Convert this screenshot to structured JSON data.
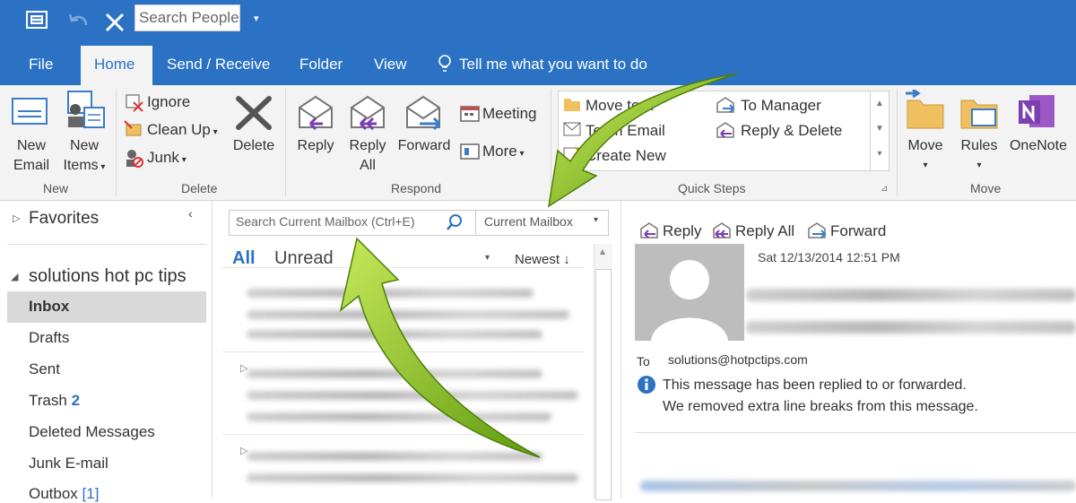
{
  "titlebar": {
    "search_people_placeholder": "Search People"
  },
  "tabs": {
    "file": "File",
    "home": "Home",
    "send_receive": "Send / Receive",
    "folder": "Folder",
    "view": "View",
    "tell_me": "Tell me what you want to do"
  },
  "ribbon": {
    "new_email": [
      "New",
      "Email"
    ],
    "new_items": [
      "New",
      "Items"
    ],
    "group_new": "New",
    "ignore": "Ignore",
    "clean_up": "Clean Up",
    "junk": "Junk",
    "delete": "Delete",
    "group_delete": "Delete",
    "reply": "Reply",
    "reply_all": [
      "Reply",
      "All"
    ],
    "forward": "Forward",
    "meeting": "Meeting",
    "more": "More",
    "group_respond": "Respond",
    "quick_steps": {
      "move_to": "Move to: ?",
      "team_email": "Team Email",
      "create_new": "Create New",
      "to_manager": "To Manager",
      "reply_delete": "Reply & Delete"
    },
    "group_quick_steps": "Quick Steps",
    "move": "Move",
    "rules": "Rules",
    "onenote": "OneNote",
    "group_move": "Move"
  },
  "nav": {
    "favorites": "Favorites",
    "account": "solutions hot pc tips",
    "folders": [
      {
        "label": "Inbox",
        "count": "",
        "selected": true
      },
      {
        "label": "Drafts",
        "count": ""
      },
      {
        "label": "Sent",
        "count": ""
      },
      {
        "label": "Trash",
        "count": "2"
      },
      {
        "label": "Deleted Messages",
        "count": ""
      },
      {
        "label": "Junk E-mail",
        "count": ""
      },
      {
        "label": "Outbox",
        "count": "[1]"
      }
    ]
  },
  "list": {
    "search_placeholder": "Search Current Mailbox (Ctrl+E)",
    "scope": "Current Mailbox",
    "filter_all": "All",
    "filter_unread": "Unread",
    "sort": "Newest"
  },
  "reading": {
    "reply": "Reply",
    "reply_all": "Reply All",
    "forward": "Forward",
    "date": "Sat 12/13/2014 12:51 PM",
    "to_label": "To",
    "to_address": "solutions@hotpctips.com",
    "info_line1": "This message has been replied to or forwarded.",
    "info_line2": "We removed extra line breaks from this message."
  },
  "colors": {
    "accent": "#2b72c5",
    "arrow": "#7fb51f"
  }
}
